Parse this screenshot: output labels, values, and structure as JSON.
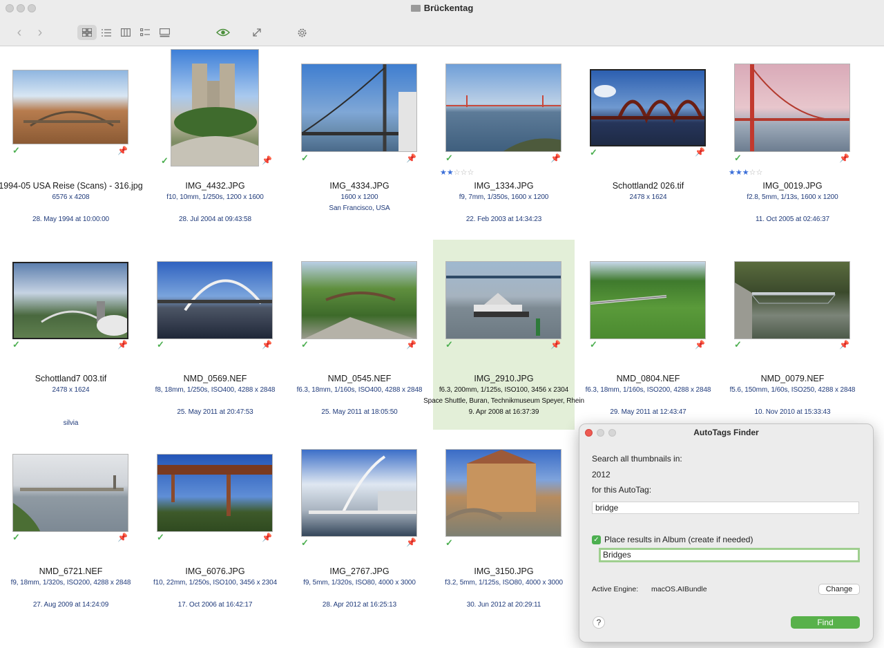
{
  "window": {
    "title": "Brückentag"
  },
  "toolbar": {
    "back": "‹",
    "forward": "›",
    "views": [
      "grid-view",
      "list-view",
      "column-view",
      "detail-list-view",
      "slideshow-view"
    ],
    "quicklook": "eye",
    "fullscreen": "expand",
    "settings": "gear"
  },
  "photos": [
    {
      "name": "1994-05 USA Reise (Scans) - 316.jpg",
      "info": "6576 x 4208",
      "extra": "",
      "date": "28. May 1994 at 10:00:00",
      "rating": 0
    },
    {
      "name": "IMG_4432.JPG",
      "info": "f10, 10mm, 1/250s, 1200 x 1600",
      "extra": "",
      "date": "28. Jul 2004 at 09:43:58",
      "rating": 0
    },
    {
      "name": "IMG_4334.JPG",
      "info": "1600 x 1200",
      "extra": "San Francisco, USA",
      "date": "",
      "rating": 0
    },
    {
      "name": "IMG_1334.JPG",
      "info": "f9, 7mm, 1/350s, 1600 x 1200",
      "extra": "",
      "date": "22. Feb 2003 at 14:34:23",
      "rating": 2
    },
    {
      "name": "Schottland2 026.tif",
      "info": "2478 x 1624",
      "extra": "",
      "date": "",
      "rating": 0
    },
    {
      "name": "IMG_0019.JPG",
      "info": "f2.8, 5mm, 1/13s, 1600 x 1200",
      "extra": "",
      "date": "11. Oct 2005 at 02:46:37",
      "rating": 3
    },
    {
      "name": "Schottland7 003.tif",
      "info": "2478 x 1624",
      "extra": "",
      "date": "silvia",
      "rating": 0
    },
    {
      "name": "NMD_0569.NEF",
      "info": "f8, 18mm, 1/250s, ISO400, 4288 x 2848",
      "extra": "",
      "date": "25. May 2011 at 20:47:53",
      "rating": 0
    },
    {
      "name": "NMD_0545.NEF",
      "info": "f6.3, 18mm, 1/160s, ISO400, 4288 x 2848",
      "extra": "",
      "date": "25. May 2011 at 18:05:50",
      "rating": 0
    },
    {
      "name": "IMG_2910.JPG",
      "info": "f6.3, 200mm, 1/125s, ISO100, 3456 x 2304",
      "extra": "Space Shuttle, Buran, Technikmuseum Speyer, Rhein",
      "date": "9. Apr 2008 at 16:37:39",
      "rating": 0
    },
    {
      "name": "NMD_0804.NEF",
      "info": "f6.3, 18mm, 1/160s, ISO200, 4288 x 2848",
      "extra": "",
      "date": "29. May 2011 at 12:43:47",
      "rating": 0
    },
    {
      "name": "NMD_0079.NEF",
      "info": "f5.6, 150mm, 1/60s, ISO250, 4288 x 2848",
      "extra": "",
      "date": "10. Nov 2010 at 15:33:43",
      "rating": 0
    },
    {
      "name": "NMD_6721.NEF",
      "info": "f9, 18mm, 1/320s, ISO200, 4288 x 2848",
      "extra": "",
      "date": "27. Aug 2009 at 14:24:09",
      "rating": 0
    },
    {
      "name": "IMG_6076.JPG",
      "info": "f10, 22mm, 1/250s, ISO100, 3456 x 2304",
      "extra": "",
      "date": "17. Oct 2006 at 16:42:17",
      "rating": 0
    },
    {
      "name": "IMG_2767.JPG",
      "info": "f9, 5mm, 1/320s, ISO80, 4000 x 3000",
      "extra": "",
      "date": "28. Apr 2012 at 16:25:13",
      "rating": 0
    },
    {
      "name": "IMG_3150.JPG",
      "info": "f3.2, 5mm, 1/125s, ISO80, 4000 x 3000",
      "extra": "",
      "date": "30. Jun 2012 at 20:29:11",
      "rating": 0
    }
  ],
  "dialog": {
    "title": "AutoTags Finder",
    "search_label": "Search all thumbnails in:",
    "search_scope": "2012",
    "tag_label": "for this AutoTag:",
    "tag_value": "bridge",
    "album_checkbox_label": "Place results in Album (create if needed)",
    "album_value": "Bridges",
    "engine_label": "Active Engine:",
    "engine_value": "macOS.AIBundle",
    "change_button": "Change",
    "find_button": "Find",
    "help_button": "?"
  },
  "colors": {
    "accent_green": "#58b14a",
    "check_green": "#4caf50",
    "pin_red": "#d9534f",
    "selected_bg": "#e3efd8",
    "meta_blue": "#1f3a7a"
  }
}
